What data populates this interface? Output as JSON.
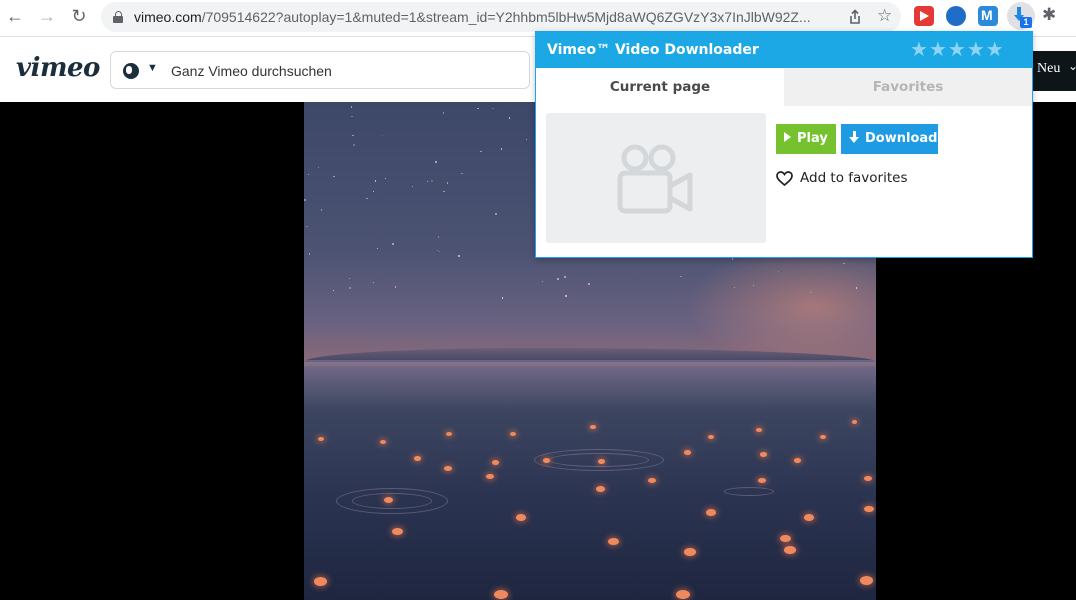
{
  "browser": {
    "url_host": "vimeo.com",
    "url_rest": "/709514622?autoplay=1&muted=1&stream_id=Y2hhbm5lbHw5Mjd8aWQ6ZGVzY3x7InJlbW92Z...",
    "extension_badge": "1"
  },
  "vimeo": {
    "logo": "vimeo",
    "search_placeholder": "Ganz Vimeo durchsuchen",
    "new_label": "Neu"
  },
  "popup": {
    "title": "Vimeo™ Video Downloader",
    "rating": 5,
    "tabs": [
      {
        "label": "Current page",
        "active": true
      },
      {
        "label": "Favorites",
        "active": false
      }
    ],
    "play_label": "Play",
    "download_label": "Download",
    "favorites_label": "Add to favorites"
  },
  "colors": {
    "popup_header": "#1ca8e4",
    "play": "#76c22e",
    "download": "#1e9be3"
  }
}
